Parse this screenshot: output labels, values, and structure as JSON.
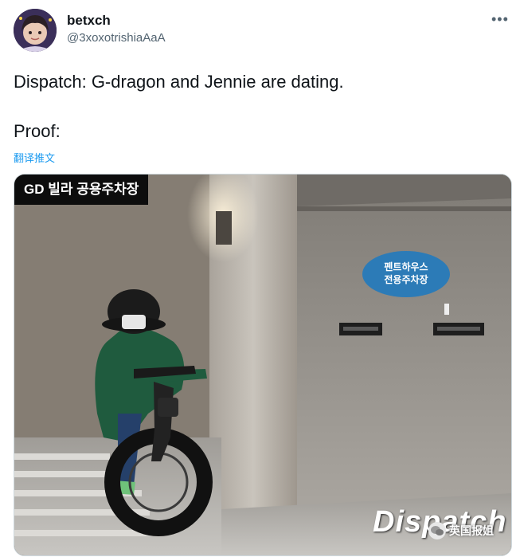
{
  "user": {
    "display_name": "betxch",
    "handle": "@3xoxotrishiaAaA"
  },
  "more_icon": "more-horizontal-icon",
  "tweet": {
    "line1": "Dispatch: G-dragon and Jennie are dating.",
    "line2": "Proof:",
    "translate_label": "翻译推文"
  },
  "media": {
    "caption": "GD 빌라 공용주차장",
    "sign_line1": "펜트하우스",
    "sign_line2": "전용주차장",
    "watermark": "Dispatch"
  },
  "overlay": {
    "text": "英国报姐",
    "icon": "wechat-logo-icon"
  }
}
